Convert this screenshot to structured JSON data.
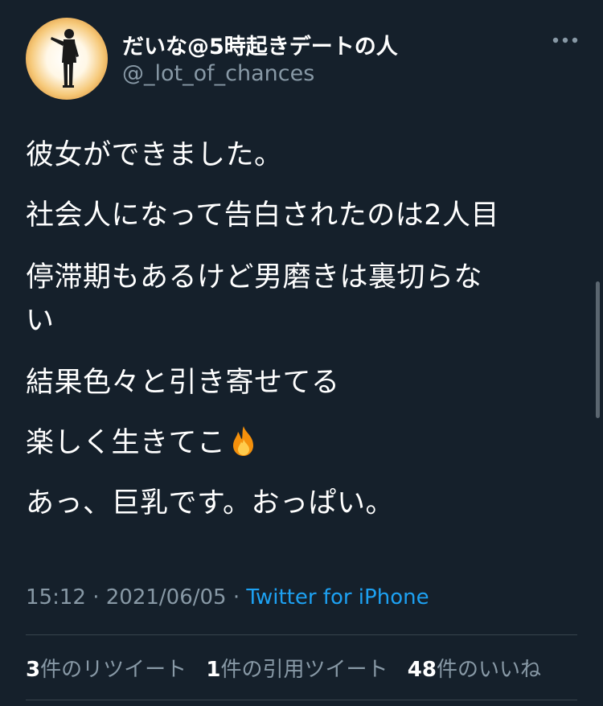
{
  "user": {
    "display_name": "だいな@5時起きデートの人",
    "handle": "@_lot_of_chances"
  },
  "tweet": {
    "lines": [
      "彼女ができました。",
      "社会人になって告白されたのは2人目",
      "停滞期もあるけど男磨きは裏切らな\nい",
      "結果色々と引き寄せてる",
      "楽しく生きてこ",
      "あっ、巨乳です。おっぱい。"
    ],
    "emoji_icon": "fire-icon"
  },
  "meta": {
    "time": "15:12",
    "sep1": " · ",
    "date": "2021/06/05",
    "sep2": " · ",
    "source": "Twitter for iPhone"
  },
  "stats": {
    "retweets_count": "3",
    "retweets_label": "件のリツイート",
    "quotes_count": "1",
    "quotes_label": "件の引用ツイート",
    "likes_count": "48",
    "likes_label": "件のいいね"
  },
  "colors": {
    "background": "#15202b",
    "secondary_text": "#8899a6",
    "link": "#1da1f2",
    "divider": "#38444d"
  }
}
